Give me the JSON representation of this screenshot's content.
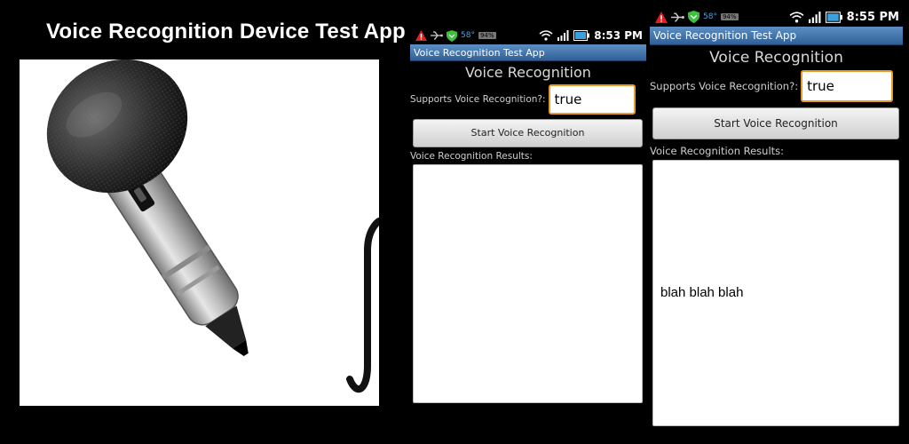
{
  "banner": {
    "title": "Voice Recognition Device Test App"
  },
  "illustration": {
    "subject": "microphone-icon"
  },
  "screens": [
    {
      "status": {
        "temperature": "58°",
        "battery": "94%",
        "time": "8:53 PM"
      },
      "app_title": "Voice Recognition Test App",
      "heading": "Voice Recognition",
      "supports_label": "Supports Voice Recognition?:",
      "supports_value": "true",
      "button_label": "Start Voice Recognition",
      "results_label": "Voice Recognition Results:",
      "results_text": ""
    },
    {
      "status": {
        "temperature": "58°",
        "battery": "94%",
        "time": "8:55 PM"
      },
      "app_title": "Voice Recognition Test App",
      "heading": "Voice Recognition",
      "supports_label": "Supports Voice Recognition?:",
      "supports_value": "true",
      "button_label": "Start Voice Recognition",
      "results_label": "Voice Recognition Results:",
      "results_text": "blah blah blah"
    }
  ],
  "colors": {
    "background": "#000000",
    "title_bar": "#3f6fa6",
    "input_focus": "#e89a2a",
    "temp_text": "#4aa3df",
    "alert_icon": "#e02020",
    "shield_icon": "#3fbf3f"
  }
}
